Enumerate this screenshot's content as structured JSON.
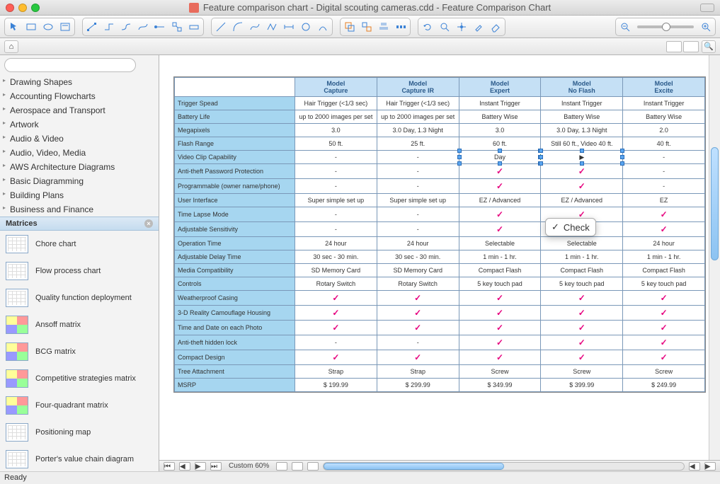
{
  "window_title": "Feature comparison chart - Digital scouting cameras.cdd - Feature Comparison Chart",
  "status": "Ready",
  "zoom_label": "Custom 60%",
  "popup_text": "Check",
  "sidebar": {
    "categories": [
      "Drawing Shapes",
      "Accounting Flowcharts",
      "Aerospace and Transport",
      "Artwork",
      "Audio & Video",
      "Audio, Video, Media",
      "AWS Architecture Diagrams",
      "Basic Diagramming",
      "Building Plans",
      "Business and Finance"
    ],
    "active_category": "Matrices",
    "templates": [
      "Chore chart",
      "Flow process chart",
      "Quality function deployment",
      "Ansoff matrix",
      "BCG matrix",
      "Competitive strategies matrix",
      "Four-quadrant matrix",
      "Positioning map",
      "Porter's value chain diagram"
    ]
  },
  "chart_data": {
    "type": "table",
    "title": "Feature Comparison Chart",
    "columns": [
      {
        "l1": "Model",
        "l2": "Capture"
      },
      {
        "l1": "Model",
        "l2": "Capture IR"
      },
      {
        "l1": "Model",
        "l2": "Expert"
      },
      {
        "l1": "Model",
        "l2": "No Flash"
      },
      {
        "l1": "Model",
        "l2": "Excite"
      }
    ],
    "rows": [
      {
        "label": "Trigger Spead",
        "v": [
          "Hair Trigger (<1/3 sec)",
          "Hair Trigger (<1/3 sec)",
          "Instant Trigger",
          "Instant Trigger",
          "Instant Trigger"
        ]
      },
      {
        "label": "Battery Life",
        "v": [
          "up to 2000 images per set",
          "up to 2000 images per set",
          "Battery Wise",
          "Battery Wise",
          "Battery Wise"
        ]
      },
      {
        "label": "Megapixels",
        "v": [
          "3.0",
          "3.0 Day, 1.3 Night",
          "3.0",
          "3.0 Day, 1.3 Night",
          "2.0"
        ]
      },
      {
        "label": "Flash Range",
        "v": [
          "50 ft.",
          "25 ft.",
          "60 ft.",
          "Still 60 ft., Video 40 ft.",
          "40 ft."
        ]
      },
      {
        "label": "Video Clip Capability",
        "v": [
          "-",
          "-",
          "Day",
          "▶",
          "-"
        ]
      },
      {
        "label": "Anti-theft Password Protection",
        "v": [
          "-",
          "-",
          "✓",
          "✓",
          "-"
        ]
      },
      {
        "label": "Programmable (owner name/phone)",
        "v": [
          "-",
          "-",
          "✓",
          "✓",
          "-"
        ]
      },
      {
        "label": "User Interface",
        "v": [
          "Super simple set up",
          "Super simple set up",
          "EZ / Advanced",
          "EZ / Advanced",
          "EZ"
        ]
      },
      {
        "label": "Time Lapse Mode",
        "v": [
          "-",
          "-",
          "✓",
          "✓",
          "✓"
        ]
      },
      {
        "label": "Adjustable Sensitivity",
        "v": [
          "-",
          "-",
          "✓",
          "✓",
          "✓"
        ]
      },
      {
        "label": "Operation Time",
        "v": [
          "24 hour",
          "24 hour",
          "Selectable",
          "Selectable",
          "24 hour"
        ]
      },
      {
        "label": "Adjustable Delay Time",
        "v": [
          "30 sec - 30 min.",
          "30 sec - 30 min.",
          "1 min - 1 hr.",
          "1 min - 1 hr.",
          "1 min - 1 hr."
        ]
      },
      {
        "label": "Media Compatibility",
        "v": [
          "SD Memory Card",
          "SD Memory Card",
          "Compact Flash",
          "Compact Flash",
          "Compact Flash"
        ]
      },
      {
        "label": "Controls",
        "v": [
          "Rotary Switch",
          "Rotary Switch",
          "5 key touch pad",
          "5 key touch pad",
          "5 key touch pad"
        ]
      },
      {
        "label": "Weatherproof Casing",
        "v": [
          "✓",
          "✓",
          "✓",
          "✓",
          "✓"
        ]
      },
      {
        "label": "3-D Reality Camouflage Housing",
        "v": [
          "✓",
          "✓",
          "✓",
          "✓",
          "✓"
        ]
      },
      {
        "label": "Time and Date on each Photo",
        "v": [
          "✓",
          "✓",
          "✓",
          "✓",
          "✓"
        ]
      },
      {
        "label": "Anti-theft hidden lock",
        "v": [
          "-",
          "-",
          "✓",
          "✓",
          "✓"
        ]
      },
      {
        "label": "Compact Design",
        "v": [
          "✓",
          "✓",
          "✓",
          "✓",
          "✓"
        ]
      },
      {
        "label": "Tree Attachment",
        "v": [
          "Strap",
          "Strap",
          "Screw",
          "Screw",
          "Screw"
        ]
      },
      {
        "label": "MSRP",
        "v": [
          "$ 199.99",
          "$ 299.99",
          "$ 349.99",
          "$ 399.99",
          "$ 249.99"
        ]
      }
    ]
  }
}
